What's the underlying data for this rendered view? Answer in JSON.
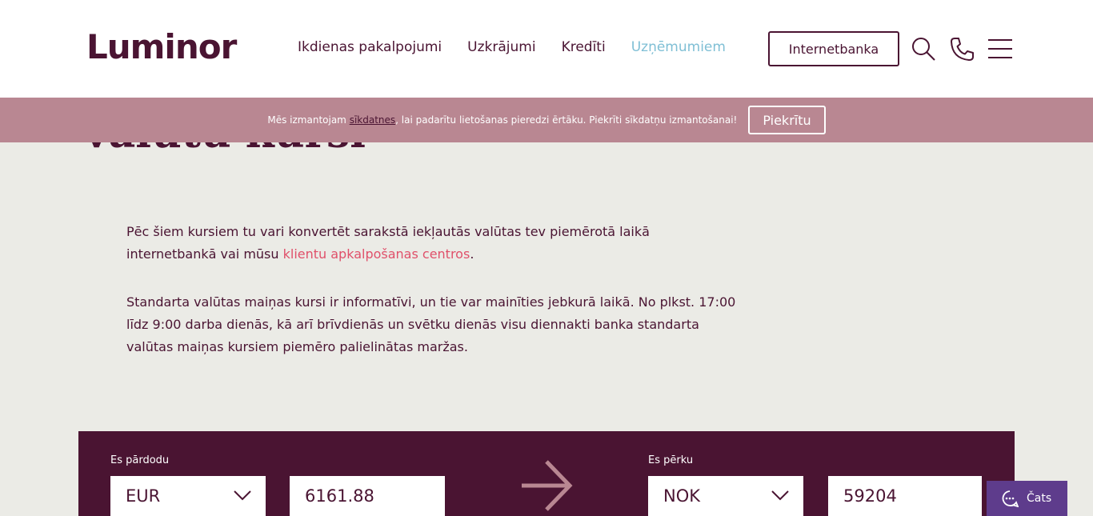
{
  "header": {
    "logo": "Luminor",
    "nav": [
      {
        "label": "Ikdienas pakalpojumi",
        "active": false
      },
      {
        "label": "Uzkrājumi",
        "active": false
      },
      {
        "label": "Kredīti",
        "active": false
      },
      {
        "label": "Uzņēmumiem",
        "active": true
      }
    ],
    "internetbank_label": "Internetbanka",
    "icons": [
      "search-icon",
      "phone-icon",
      "menu-icon"
    ]
  },
  "cookie": {
    "text_before": "Mēs izmantojam ",
    "link": "sīkdatnes",
    "text_after": ", lai padarītu lietošanas pieredzi ērtāku. Piekrīti sīkdatņu izmantošanai!",
    "accept_label": "Piekrītu"
  },
  "page": {
    "title": "Valūtu kursi",
    "para1_before": "Pēc šiem kursiem tu vari konvertēt sarakstā iekļautās valūtas tev piemērotā laikā internetbankā vai mūsu ",
    "para1_link": "klientu apkalpošanas centros",
    "para1_after": ".",
    "para2": "Standarta valūtas maiņas kursi ir informatīvi, un tie var mainīties jebkurā laikā. No plkst. 17:00 līdz 9:00 darba dienās, kā arī brīvdienās un svētku dienās visu diennakti banka standarta valūtas maiņas kursiem piemēro palielinātas maržas."
  },
  "converter": {
    "sell_label": "Es pārdodu",
    "sell_currency": "EUR",
    "sell_amount": "6161.88",
    "buy_label": "Es pērku",
    "buy_currency": "NOK",
    "buy_amount": "59204"
  },
  "chat": {
    "label": "Čats"
  },
  "colors": {
    "brand": "#4a1432",
    "accent_link": "#e0506a",
    "active_nav": "#7fbfd5",
    "cookie_bar": "#b98792",
    "chat": "#5e3c8c"
  }
}
